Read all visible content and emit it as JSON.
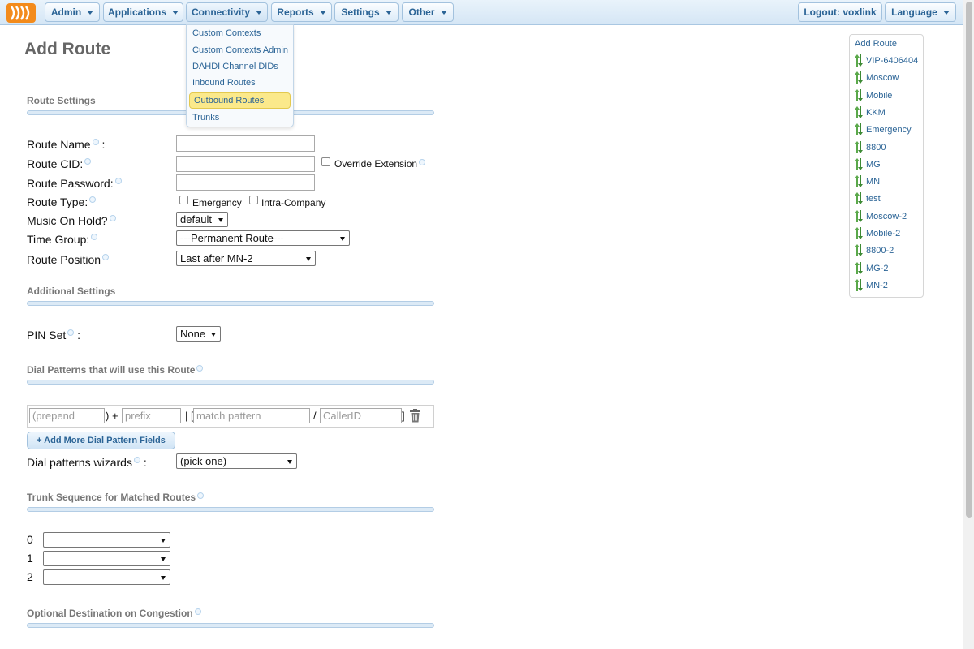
{
  "nav": {
    "menus": [
      "Admin",
      "Applications",
      "Connectivity",
      "Reports",
      "Settings",
      "Other"
    ],
    "logout": "Logout: voxlink",
    "language": "Language",
    "dropdown": [
      "Custom Contexts",
      "Custom Contexts Admin",
      "DAHDI Channel DIDs",
      "Inbound Routes",
      "Outbound Routes",
      "Trunks"
    ]
  },
  "page": {
    "title": "Add Route",
    "sections": {
      "route_settings": "Route Settings",
      "additional": "Additional Settings",
      "dial_patterns": "Dial Patterns that will use this Route",
      "trunk_sequence": "Trunk Sequence for Matched Routes",
      "optional_destination": "Optional Destination on Congestion"
    },
    "labels": {
      "route_name": "Route Name",
      "route_name_suffix": " :",
      "route_cid": "Route CID:",
      "override_extension": "Override Extension",
      "route_password": "Route Password:",
      "route_type": "Route Type:",
      "emergency": "Emergency",
      "intra_company": "Intra-Company",
      "music_on_hold": "Music On Hold?",
      "time_group": "Time Group:",
      "route_position": "Route Position",
      "pin_set": "PIN Set",
      "pin_set_suffix": " :",
      "dial_wizards": "Dial patterns wizards",
      "dial_wizards_suffix": " :"
    },
    "values": {
      "music_on_hold": "default",
      "time_group": "---Permanent Route---",
      "route_position": "Last after MN-2",
      "pin_set": "None",
      "dial_wizards": "(pick one)"
    },
    "pattern": {
      "prepend": "(prepend",
      "close_paren_plus": ") +",
      "prefix": "prefix",
      "pipe_bracket": "| [",
      "match": "match pattern",
      "slash": "/",
      "callerid": "CallerID",
      "close_bracket": "]"
    },
    "add_more": "+ Add More Dial Pattern Fields",
    "trunks": [
      "0",
      "1",
      "2"
    ]
  },
  "routes": {
    "add": "Add Route",
    "items": [
      "VIP-6406404",
      "Moscow",
      "Mobile",
      "KKM",
      "Emergency",
      "8800",
      "MG",
      "MN",
      "test",
      "Moscow-2",
      "Mobile-2",
      "8800-2",
      "MG-2",
      "MN-2"
    ]
  }
}
